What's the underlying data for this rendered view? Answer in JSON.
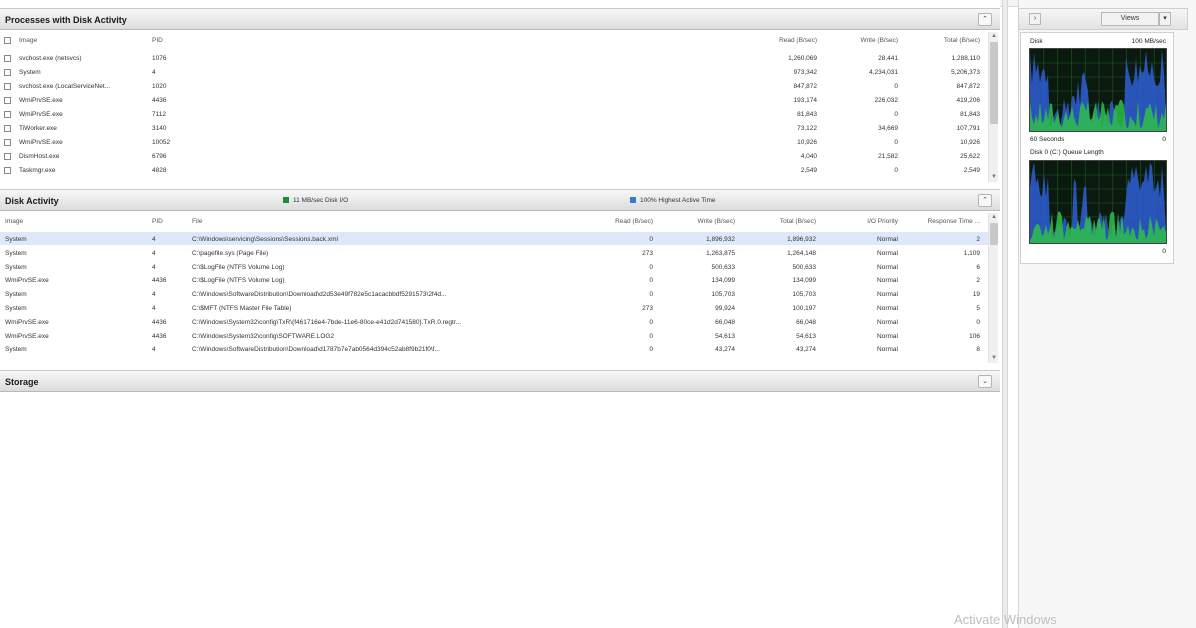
{
  "processes": {
    "title": "Processes with Disk Activity",
    "columns": [
      "Image",
      "PID",
      "Read (B/sec)",
      "Write (B/sec)",
      "Total (B/sec)"
    ],
    "rows": [
      [
        "svchost.exe (netsvcs)",
        "1076",
        "1,260,069",
        "28,441",
        "1,288,110"
      ],
      [
        "System",
        "4",
        "973,342",
        "4,234,031",
        "5,206,373"
      ],
      [
        "svchost.exe (LocalServiceNet...",
        "1020",
        "847,872",
        "0",
        "847,872"
      ],
      [
        "WmiPrvSE.exe",
        "4436",
        "193,174",
        "226,032",
        "419,206"
      ],
      [
        "WmiPrvSE.exe",
        "7112",
        "81,843",
        "0",
        "81,843"
      ],
      [
        "TiWorker.exe",
        "3140",
        "73,122",
        "34,669",
        "107,791"
      ],
      [
        "WmiPrvSE.exe",
        "10052",
        "10,926",
        "0",
        "10,926"
      ],
      [
        "DismHost.exe",
        "6796",
        "4,040",
        "21,582",
        "25,622"
      ],
      [
        "Taskmgr.exe",
        "4828",
        "2,549",
        "0",
        "2,549"
      ]
    ]
  },
  "disk_activity": {
    "title": "Disk Activity",
    "indicator_io": "11 MB/sec Disk I/O",
    "indicator_active": "100% Highest Active Time",
    "columns": [
      "Image",
      "PID",
      "File",
      "Read (B/sec)",
      "Write (B/sec)",
      "Total (B/sec)",
      "I/O Priority",
      "Response Time ..."
    ],
    "rows": [
      [
        "System",
        "4",
        "C:\\Windows\\servicing\\Sessions\\Sessions.back.xml",
        "0",
        "1,896,932",
        "1,896,932",
        "Normal",
        "2"
      ],
      [
        "System",
        "4",
        "C:\\pagefile.sys (Page File)",
        "273",
        "1,263,875",
        "1,264,148",
        "Normal",
        "1,109"
      ],
      [
        "System",
        "4",
        "C:\\$LogFile (NTFS Volume Log)",
        "0",
        "500,633",
        "500,633",
        "Normal",
        "6"
      ],
      [
        "WmiPrvSE.exe",
        "4436",
        "C:\\$LogFile (NTFS Volume Log)",
        "0",
        "134,099",
        "134,099",
        "Normal",
        "2"
      ],
      [
        "System",
        "4",
        "C:\\Windows\\SoftwareDistribution\\Download\\d2d53e49f782e5c1acacbbdf5291573\\2f4d...",
        "0",
        "105,703",
        "105,703",
        "Normal",
        "19"
      ],
      [
        "System",
        "4",
        "C:\\$MFT (NTFS Master File Table)",
        "273",
        "99,924",
        "100,197",
        "Normal",
        "5"
      ],
      [
        "WmiPrvSE.exe",
        "4436",
        "C:\\Windows\\System32\\config\\TxR\\{f461716e4-7bde-11e6-80ce-e41d2d741580}.TxR.0.regtr...",
        "0",
        "66,048",
        "66,048",
        "Normal",
        "0"
      ],
      [
        "WmiPrvSE.exe",
        "4436",
        "C:\\Windows\\System32\\config\\SOFTWARE.LOG2",
        "0",
        "54,613",
        "54,613",
        "Normal",
        "106"
      ],
      [
        "System",
        "4",
        "C:\\Windows\\SoftwareDistribution\\Download\\d1787b7e7ab0564d394c52ab8f9b21f0\\f...",
        "0",
        "43,274",
        "43,274",
        "Normal",
        "8"
      ]
    ]
  },
  "storage": {
    "title": "Storage"
  },
  "side": {
    "views_label": "Views",
    "disk_label": "Disk",
    "disk_scale": "100 MB/sec",
    "seconds_label": "60 Seconds",
    "zero1": "0",
    "queue_label": "Disk 0 (C:) Queue Length",
    "zero2": "0"
  },
  "watermark": "Activate Windows",
  "colors": {
    "graph_bg": "#0b1a0f",
    "graph_blue": "#2e5fd6",
    "graph_green": "#2fbf4a",
    "selection": "#dde9fa"
  }
}
